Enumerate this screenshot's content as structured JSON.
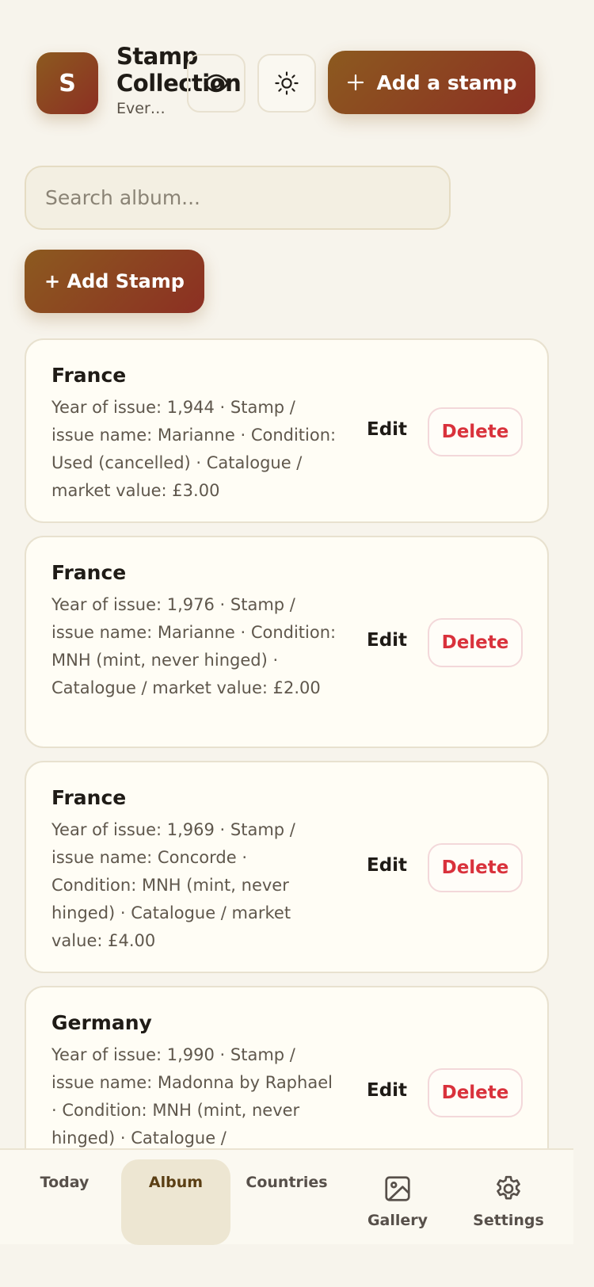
{
  "header": {
    "logo_letter": "S",
    "title": "Stamp Collection",
    "subtitle": "Ever…",
    "add_button_label": "Add a stamp"
  },
  "search": {
    "placeholder": "Search album..."
  },
  "add_stamp_label": "+ Add Stamp",
  "stamps": [
    {
      "country": "France",
      "details": "Year of issue: 1,944 · Stamp / issue name: Marianne · Condition: Used (cancelled) · Catalogue / market value: £3.00",
      "edit_label": "Edit",
      "delete_label": "Delete"
    },
    {
      "country": "France",
      "details": "Year of issue: 1,976 · Stamp / issue name: Marianne · Condition: MNH (mint, never hinged) · Catalogue / market value: £2.00",
      "edit_label": "Edit",
      "delete_label": "Delete"
    },
    {
      "country": "France",
      "details": "Year of issue: 1,969 · Stamp / issue name: Concorde · Condition: MNH (mint, never hinged) · Catalogue / market value: £4.00",
      "edit_label": "Edit",
      "delete_label": "Delete"
    },
    {
      "country": "Germany",
      "details": "Year of issue: 1,990 · Stamp / issue name: Madonna by Raphael · Condition: MNH (mint, never hinged) · Catalogue /",
      "edit_label": "Edit",
      "delete_label": "Delete"
    }
  ],
  "nav": {
    "today": "Today",
    "album": "Album",
    "countries": "Countries",
    "gallery": "Gallery",
    "settings": "Settings"
  },
  "colors": {
    "accent_gradient_start": "#8c5a1f",
    "accent_gradient_end": "#8c2f23",
    "delete_red": "#d9323c",
    "background": "#f7f4ec"
  },
  "icons": [
    "eye-icon",
    "sun-icon",
    "plus-icon",
    "gallery-icon",
    "settings-icon"
  ]
}
